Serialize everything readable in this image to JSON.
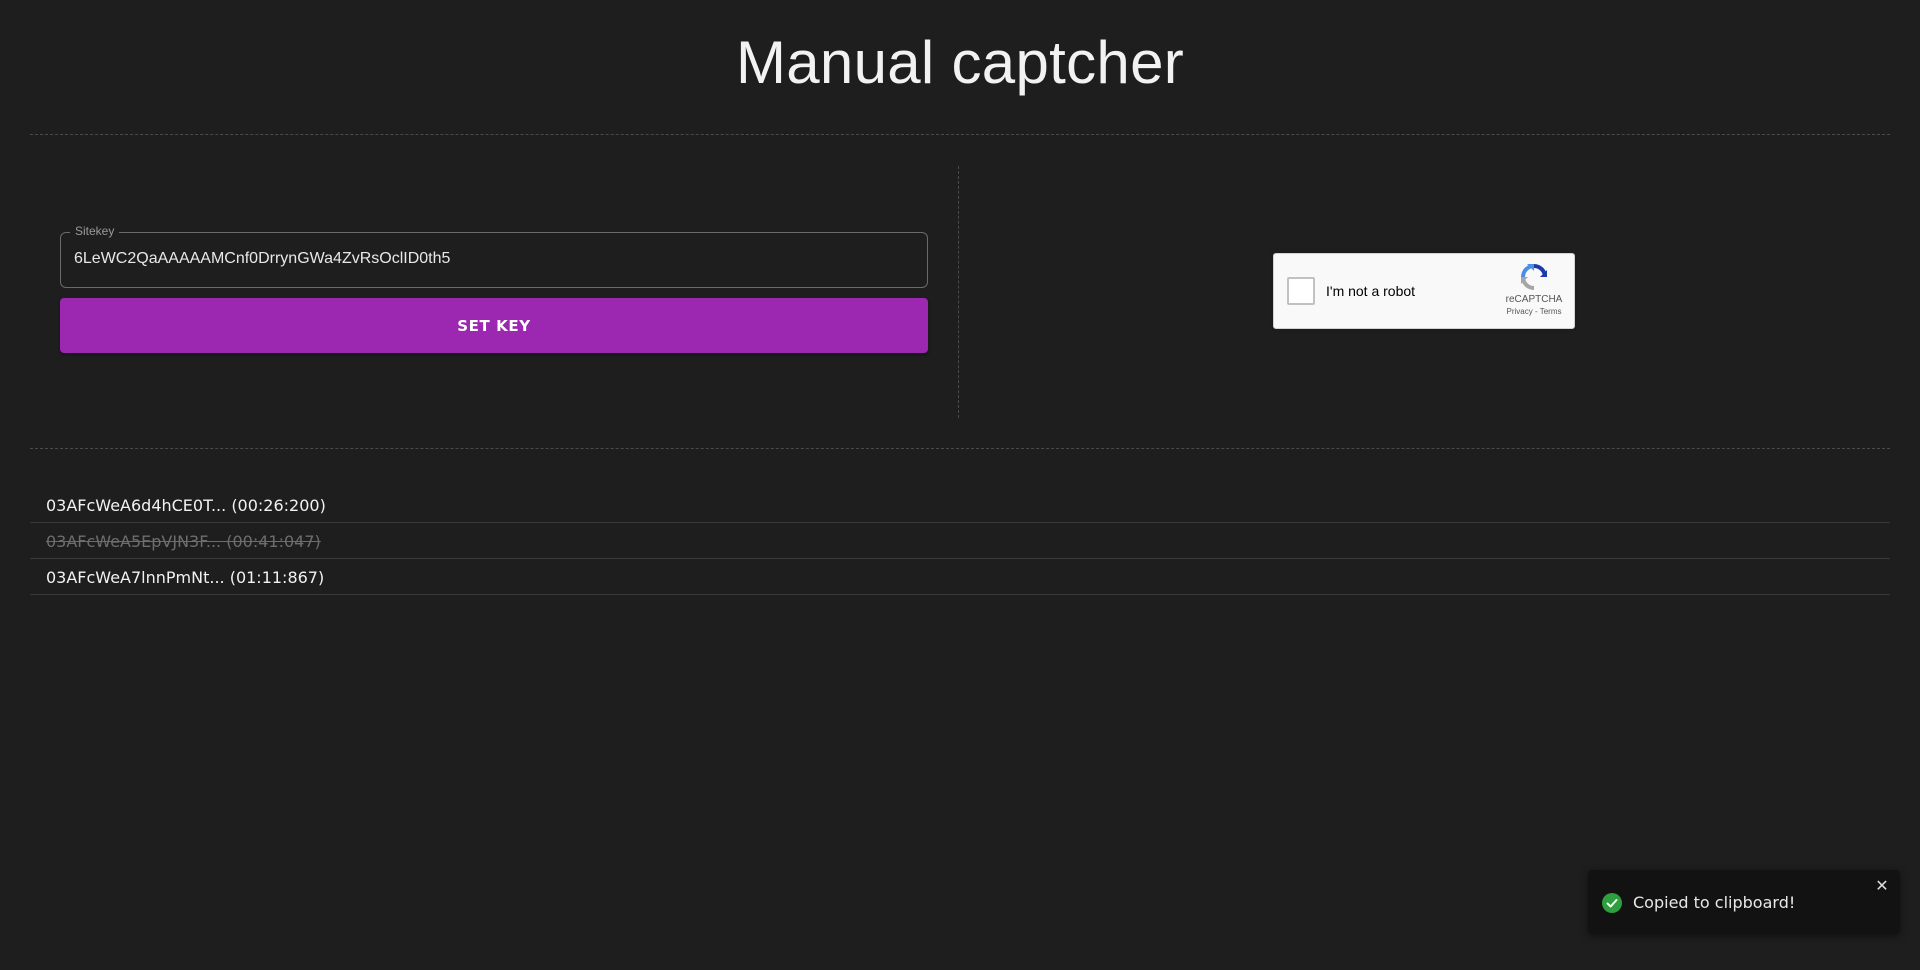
{
  "header": {
    "title": "Manual captcher"
  },
  "sitekey_form": {
    "label": "Sitekey",
    "value": "6LeWC2QaAAAAAMCnf0DrrynGWa4ZvRsOclID0th5",
    "submit_label": "SET KEY",
    "submit_color": "#9c27b0"
  },
  "recaptcha": {
    "checkbox_label": "I'm not a robot",
    "brand": "reCAPTCHA",
    "privacy_link": "Privacy",
    "separator": " - ",
    "terms_link": "Terms",
    "checked": false
  },
  "tokens": [
    {
      "text": "03AFcWeA6d4hCE0T... (00:26:200)",
      "used": false
    },
    {
      "text": "03AFcWeA5EpVJN3F... (00:41:047)",
      "used": true
    },
    {
      "text": "03AFcWeA7lnnPmNt... (01:11:867)",
      "used": false
    }
  ],
  "toast": {
    "icon": "check-circle-icon",
    "icon_color": "#2e9e3e",
    "message": "Copied to clipboard!",
    "close_glyph": "✕"
  }
}
